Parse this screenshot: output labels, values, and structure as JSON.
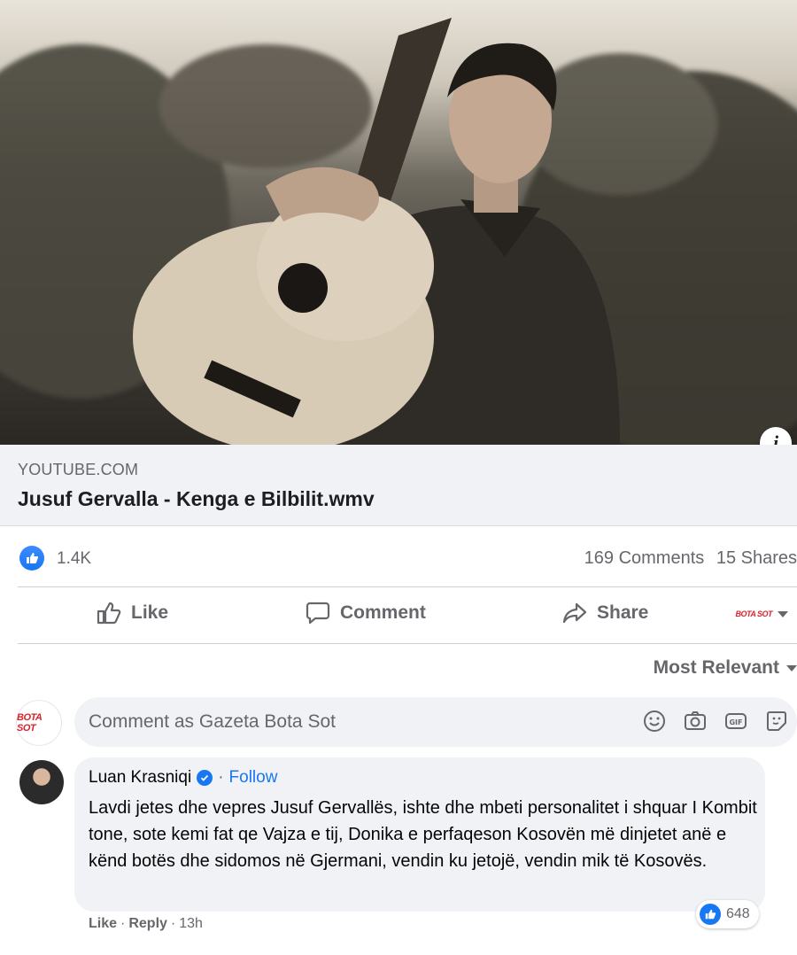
{
  "link_preview": {
    "domain": "YOUTUBE.COM",
    "title": "Jusuf Gervalla - Kenga e Bilbilit.wmv",
    "info_glyph": "i"
  },
  "stats": {
    "likes": "1.4K",
    "comments": "169 Comments",
    "shares": "15 Shares"
  },
  "actions": {
    "like": "Like",
    "comment": "Comment",
    "share": "Share",
    "page_logo": "BOTA SOT"
  },
  "sort": {
    "label": "Most Relevant"
  },
  "composer": {
    "avatar_text": "BOTA SOT",
    "placeholder": "Comment as Gazeta Bota Sot",
    "icons": [
      "emoji-icon",
      "camera-icon",
      "gif-icon",
      "sticker-icon"
    ]
  },
  "comment": {
    "author": "Luan Krasniqi",
    "separator": "·",
    "follow": "Follow",
    "text": "Lavdi jetes dhe vepres Jusuf Gervallës, ishte dhe mbeti personalitet i shquar I Kombit tone, sote kemi fat qe Vajza e tij, Donika e perfaqeson Kosovën më dinjetet anë e kënd botës dhe sidomos në Gjermani, vendin ku jetojë, vendin mik të Kosovës.",
    "reaction_count": "648",
    "like_action": "Like",
    "reply_action": "Reply",
    "time": "13h"
  },
  "colors": {
    "accent": "#1877f2",
    "secondary_text": "#65676b",
    "bubble_bg": "#f0f2f5",
    "brand_red": "#d8242b"
  }
}
